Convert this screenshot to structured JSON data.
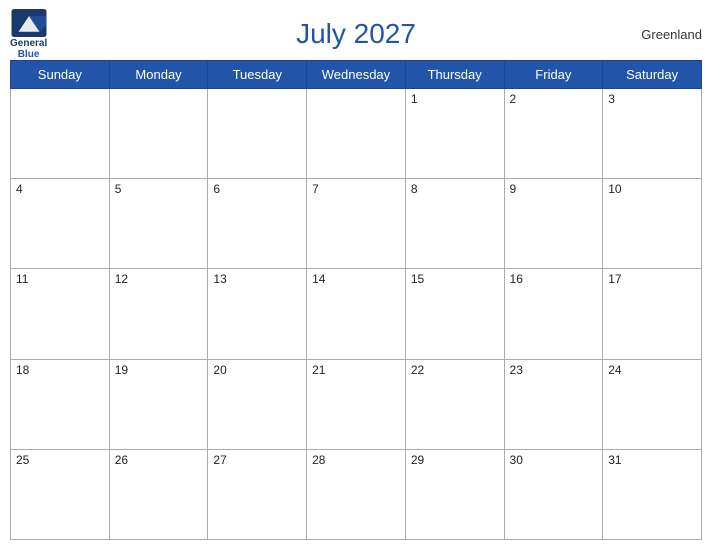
{
  "header": {
    "title": "July 2027",
    "region": "Greenland",
    "logo": {
      "line1": "General",
      "line2": "Blue"
    }
  },
  "calendar": {
    "weekdays": [
      "Sunday",
      "Monday",
      "Tuesday",
      "Wednesday",
      "Thursday",
      "Friday",
      "Saturday"
    ],
    "weeks": [
      [
        null,
        null,
        null,
        null,
        1,
        2,
        3
      ],
      [
        4,
        5,
        6,
        7,
        8,
        9,
        10
      ],
      [
        11,
        12,
        13,
        14,
        15,
        16,
        17
      ],
      [
        18,
        19,
        20,
        21,
        22,
        23,
        24
      ],
      [
        25,
        26,
        27,
        28,
        29,
        30,
        31
      ]
    ]
  }
}
